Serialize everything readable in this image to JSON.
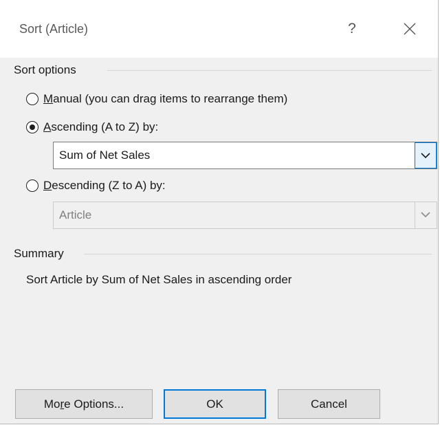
{
  "window": {
    "title": "Sort (Article)",
    "help_glyph": "?",
    "close_icon": "close-icon"
  },
  "sort_options": {
    "heading": "Sort options",
    "manual": {
      "mnemonic": "M",
      "label_rest": "anual (you can drag items to rearrange them)",
      "checked": false
    },
    "ascending": {
      "mnemonic": "A",
      "label_rest": "scending (A to Z) by:",
      "checked": true,
      "field_value": "Sum of Net Sales"
    },
    "descending": {
      "mnemonic": "D",
      "label_rest": "escending (Z to A) by:",
      "checked": false,
      "field_value": "Article",
      "enabled": false
    }
  },
  "summary": {
    "heading": "Summary",
    "text": "Sort Article by Sum of Net Sales in ascending order"
  },
  "buttons": {
    "more_options": {
      "before": "Mo",
      "mnemonic": "r",
      "after": "e Options..."
    },
    "ok": "OK",
    "cancel": "Cancel"
  },
  "colors": {
    "accent": "#0078d7",
    "dialog_bg": "#f0f0f0",
    "titlebar_bg": "#ffffff"
  }
}
